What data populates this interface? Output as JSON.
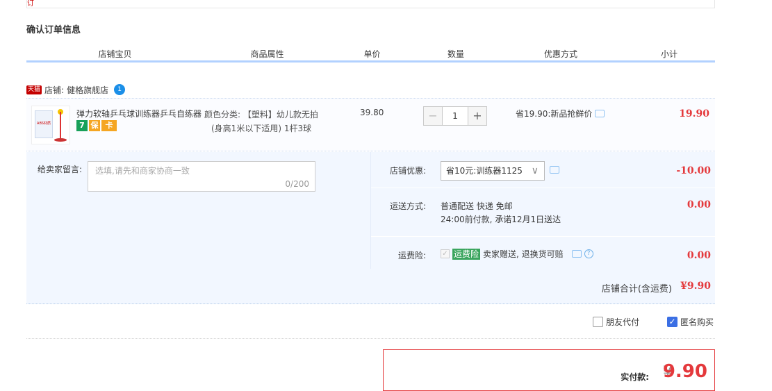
{
  "top_fragment": "订",
  "section_title": "确认订单信息",
  "columns": [
    "店铺宝贝",
    "商品属性",
    "单价",
    "数量",
    "优惠方式",
    "小计"
  ],
  "shop": {
    "badge": "天猫",
    "label": "店铺:",
    "name": "健格旗舰店",
    "ww_icon": "1"
  },
  "item": {
    "title": "弹力软轴乒乓球训练器乒乓自练器",
    "thumb_text": "ABS材质",
    "badges": [
      {
        "text": "7",
        "color": "#18a05a"
      },
      {
        "text": "保",
        "color": "#f5a623"
      },
      {
        "text": "卡",
        "color": "#f5a623"
      }
    ],
    "attr_line1": "颜色分类: 【塑料】幼儿款无拍",
    "attr_line2": "(身高1米以下适用) 1杆3球",
    "price": "39.80",
    "qty_minus": "−",
    "qty": "1",
    "qty_plus": "+",
    "discount": "省19.90:新品抢鲜价",
    "subtotal": "19.90"
  },
  "message": {
    "label": "给卖家留言:",
    "placeholder": "选填,请先和商家协商一致",
    "counter": "0/200"
  },
  "shop_discount": {
    "label": "店铺优惠:",
    "value": "省10元:训练器1125",
    "amount": "-10.00"
  },
  "shipping": {
    "label": "运送方式:",
    "line1": "普通配送 快递 免邮",
    "line2": "24:00前付款, 承诺12月1日送达",
    "amount": "0.00"
  },
  "insurance": {
    "label": "运费险:",
    "tag": "运费险",
    "text": "卖家赠送, 退换货可赔",
    "amount": "0.00"
  },
  "shop_total": {
    "label": "店铺合计(含运费)",
    "amount": "¥9.90"
  },
  "options": {
    "friend_pay": "朋友代付",
    "anonymous": "匿名购买",
    "anonymous_checked": true,
    "friend_checked": false
  },
  "payment": {
    "label": "实付款:",
    "currency": "¥",
    "amount": "9.90"
  }
}
